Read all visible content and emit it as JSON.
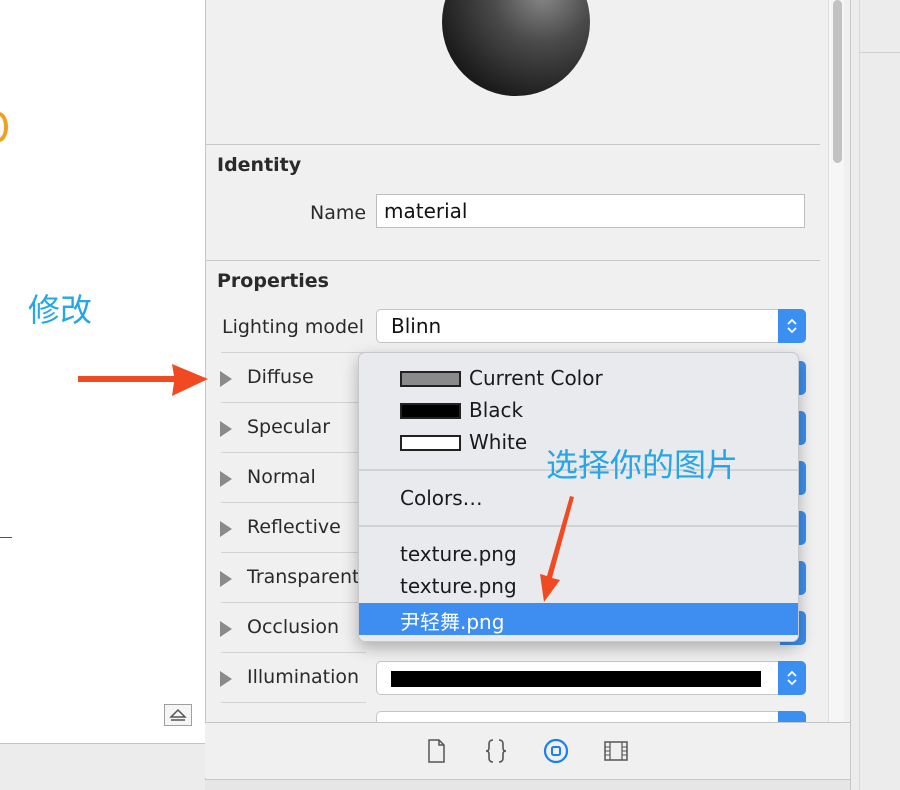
{
  "preview": {
    "label": "material preview sphere"
  },
  "identity": {
    "title": "Identity",
    "name_label": "Name",
    "name_value": "material"
  },
  "properties": {
    "title": "Properties",
    "lighting_label": "Lighting model",
    "lighting_value": "Blinn",
    "rows": [
      {
        "label": "Diffuse"
      },
      {
        "label": "Specular"
      },
      {
        "label": "Normal"
      },
      {
        "label": "Reflective"
      },
      {
        "label": "Transparent"
      },
      {
        "label": "Occlusion"
      },
      {
        "label": "Illumination"
      }
    ],
    "illumination_swatch_color": "#000000"
  },
  "menu": {
    "items": [
      {
        "label": "Current Color",
        "swatch": "#8a8a8a"
      },
      {
        "label": "Black",
        "swatch": "#000000"
      },
      {
        "label": "White",
        "swatch": "#ffffff"
      },
      {
        "label": "Colors…"
      },
      {
        "label": "texture.png"
      },
      {
        "label": "texture.png"
      },
      {
        "label": "尹轻舞.png",
        "selected": true
      }
    ]
  },
  "annotations": {
    "modify": "修改",
    "choose_image": "选择你的图片",
    "color": "#26a6e6",
    "arrow_color": "#f04a22"
  },
  "toolbar": {
    "icons": [
      "file-icon",
      "braces-icon",
      "material-inspector-icon",
      "film-icon"
    ],
    "active_color": "#1a7ff0"
  }
}
